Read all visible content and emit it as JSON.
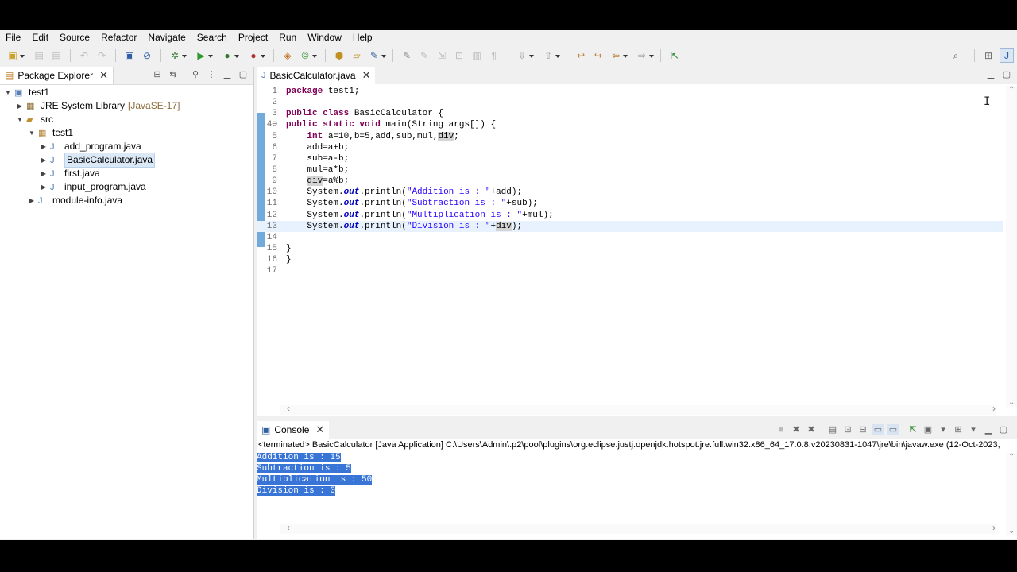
{
  "menu": [
    "File",
    "Edit",
    "Source",
    "Refactor",
    "Navigate",
    "Search",
    "Project",
    "Run",
    "Window",
    "Help"
  ],
  "package_explorer": {
    "title": "Package Explorer",
    "tree": [
      {
        "label": "test1",
        "depth": 0,
        "expanded": true,
        "icon": "project-icon"
      },
      {
        "label": "JRE System Library",
        "suffix": "[JavaSE-17]",
        "depth": 1,
        "expanded": false,
        "icon": "library-icon"
      },
      {
        "label": "src",
        "depth": 1,
        "expanded": true,
        "icon": "source-folder-icon"
      },
      {
        "label": "test1",
        "depth": 2,
        "expanded": true,
        "icon": "package-icon"
      },
      {
        "label": "add_program.java",
        "depth": 3,
        "expanded": false,
        "icon": "java-file-icon"
      },
      {
        "label": "BasicCalculator.java",
        "depth": 3,
        "expanded": false,
        "icon": "java-file-icon",
        "selected": true
      },
      {
        "label": "first.java",
        "depth": 3,
        "expanded": false,
        "icon": "java-file-icon"
      },
      {
        "label": "input_program.java",
        "depth": 3,
        "expanded": false,
        "icon": "java-file-icon"
      },
      {
        "label": "module-info.java",
        "depth": 2,
        "expanded": false,
        "icon": "java-file-icon"
      }
    ]
  },
  "editor": {
    "tab_title": "BasicCalculator.java",
    "current_line": 13,
    "lines": [
      {
        "n": "1",
        "html": "<span class='kw'>package</span> test1;"
      },
      {
        "n": "2",
        "html": ""
      },
      {
        "n": "3",
        "html": "<span class='kw'>public class</span> BasicCalculator {"
      },
      {
        "n": "4⊖",
        "html": "<span class='kw'>public static void</span> main(String args[]) {"
      },
      {
        "n": "5",
        "html": "    <span class='kw'>int</span> a=10,b=5,add,sub,mul,<span class='occ'>div</span>;"
      },
      {
        "n": "6",
        "html": "    add=a+b;"
      },
      {
        "n": "7",
        "html": "    sub=a-b;"
      },
      {
        "n": "8",
        "html": "    mul=a*b;"
      },
      {
        "n": "9",
        "html": "    <span class='occ'>div</span>=a%b;"
      },
      {
        "n": "10",
        "html": "    System.<span class='fld'>out</span>.println(<span class='st'>\"Addition is : \"</span>+add);"
      },
      {
        "n": "11",
        "html": "    System.<span class='fld'>out</span>.println(<span class='st'>\"Subtraction is : \"</span>+sub);"
      },
      {
        "n": "12",
        "html": "    System.<span class='fld'>out</span>.println(<span class='st'>\"Multiplication is : \"</span>+mul);"
      },
      {
        "n": "13",
        "html": "    System.<span class='fld'>out</span>.println(<span class='st'>\"Division is : \"</span>+<span class='occ'>div</span>);"
      },
      {
        "n": "14",
        "html": ""
      },
      {
        "n": "15",
        "html": "}"
      },
      {
        "n": "16",
        "html": "}"
      },
      {
        "n": "17",
        "html": ""
      }
    ]
  },
  "console": {
    "title": "Console",
    "terminated": "<terminated> BasicCalculator [Java Application] C:\\Users\\Admin\\.p2\\pool\\plugins\\org.eclipse.justj.openjdk.hotspot.jre.full.win32.x86_64_17.0.8.v20230831-1047\\jre\\bin\\javaw.exe  (12-Oct-2023,",
    "output": [
      "Addition is : 15",
      "Subtraction is : 5",
      "Multiplication is : 50",
      "Division is : 0"
    ]
  },
  "colors": {
    "keyword": "#7f0055",
    "string": "#2a00ff",
    "field": "#0000c0",
    "selection": "#3875d7"
  }
}
